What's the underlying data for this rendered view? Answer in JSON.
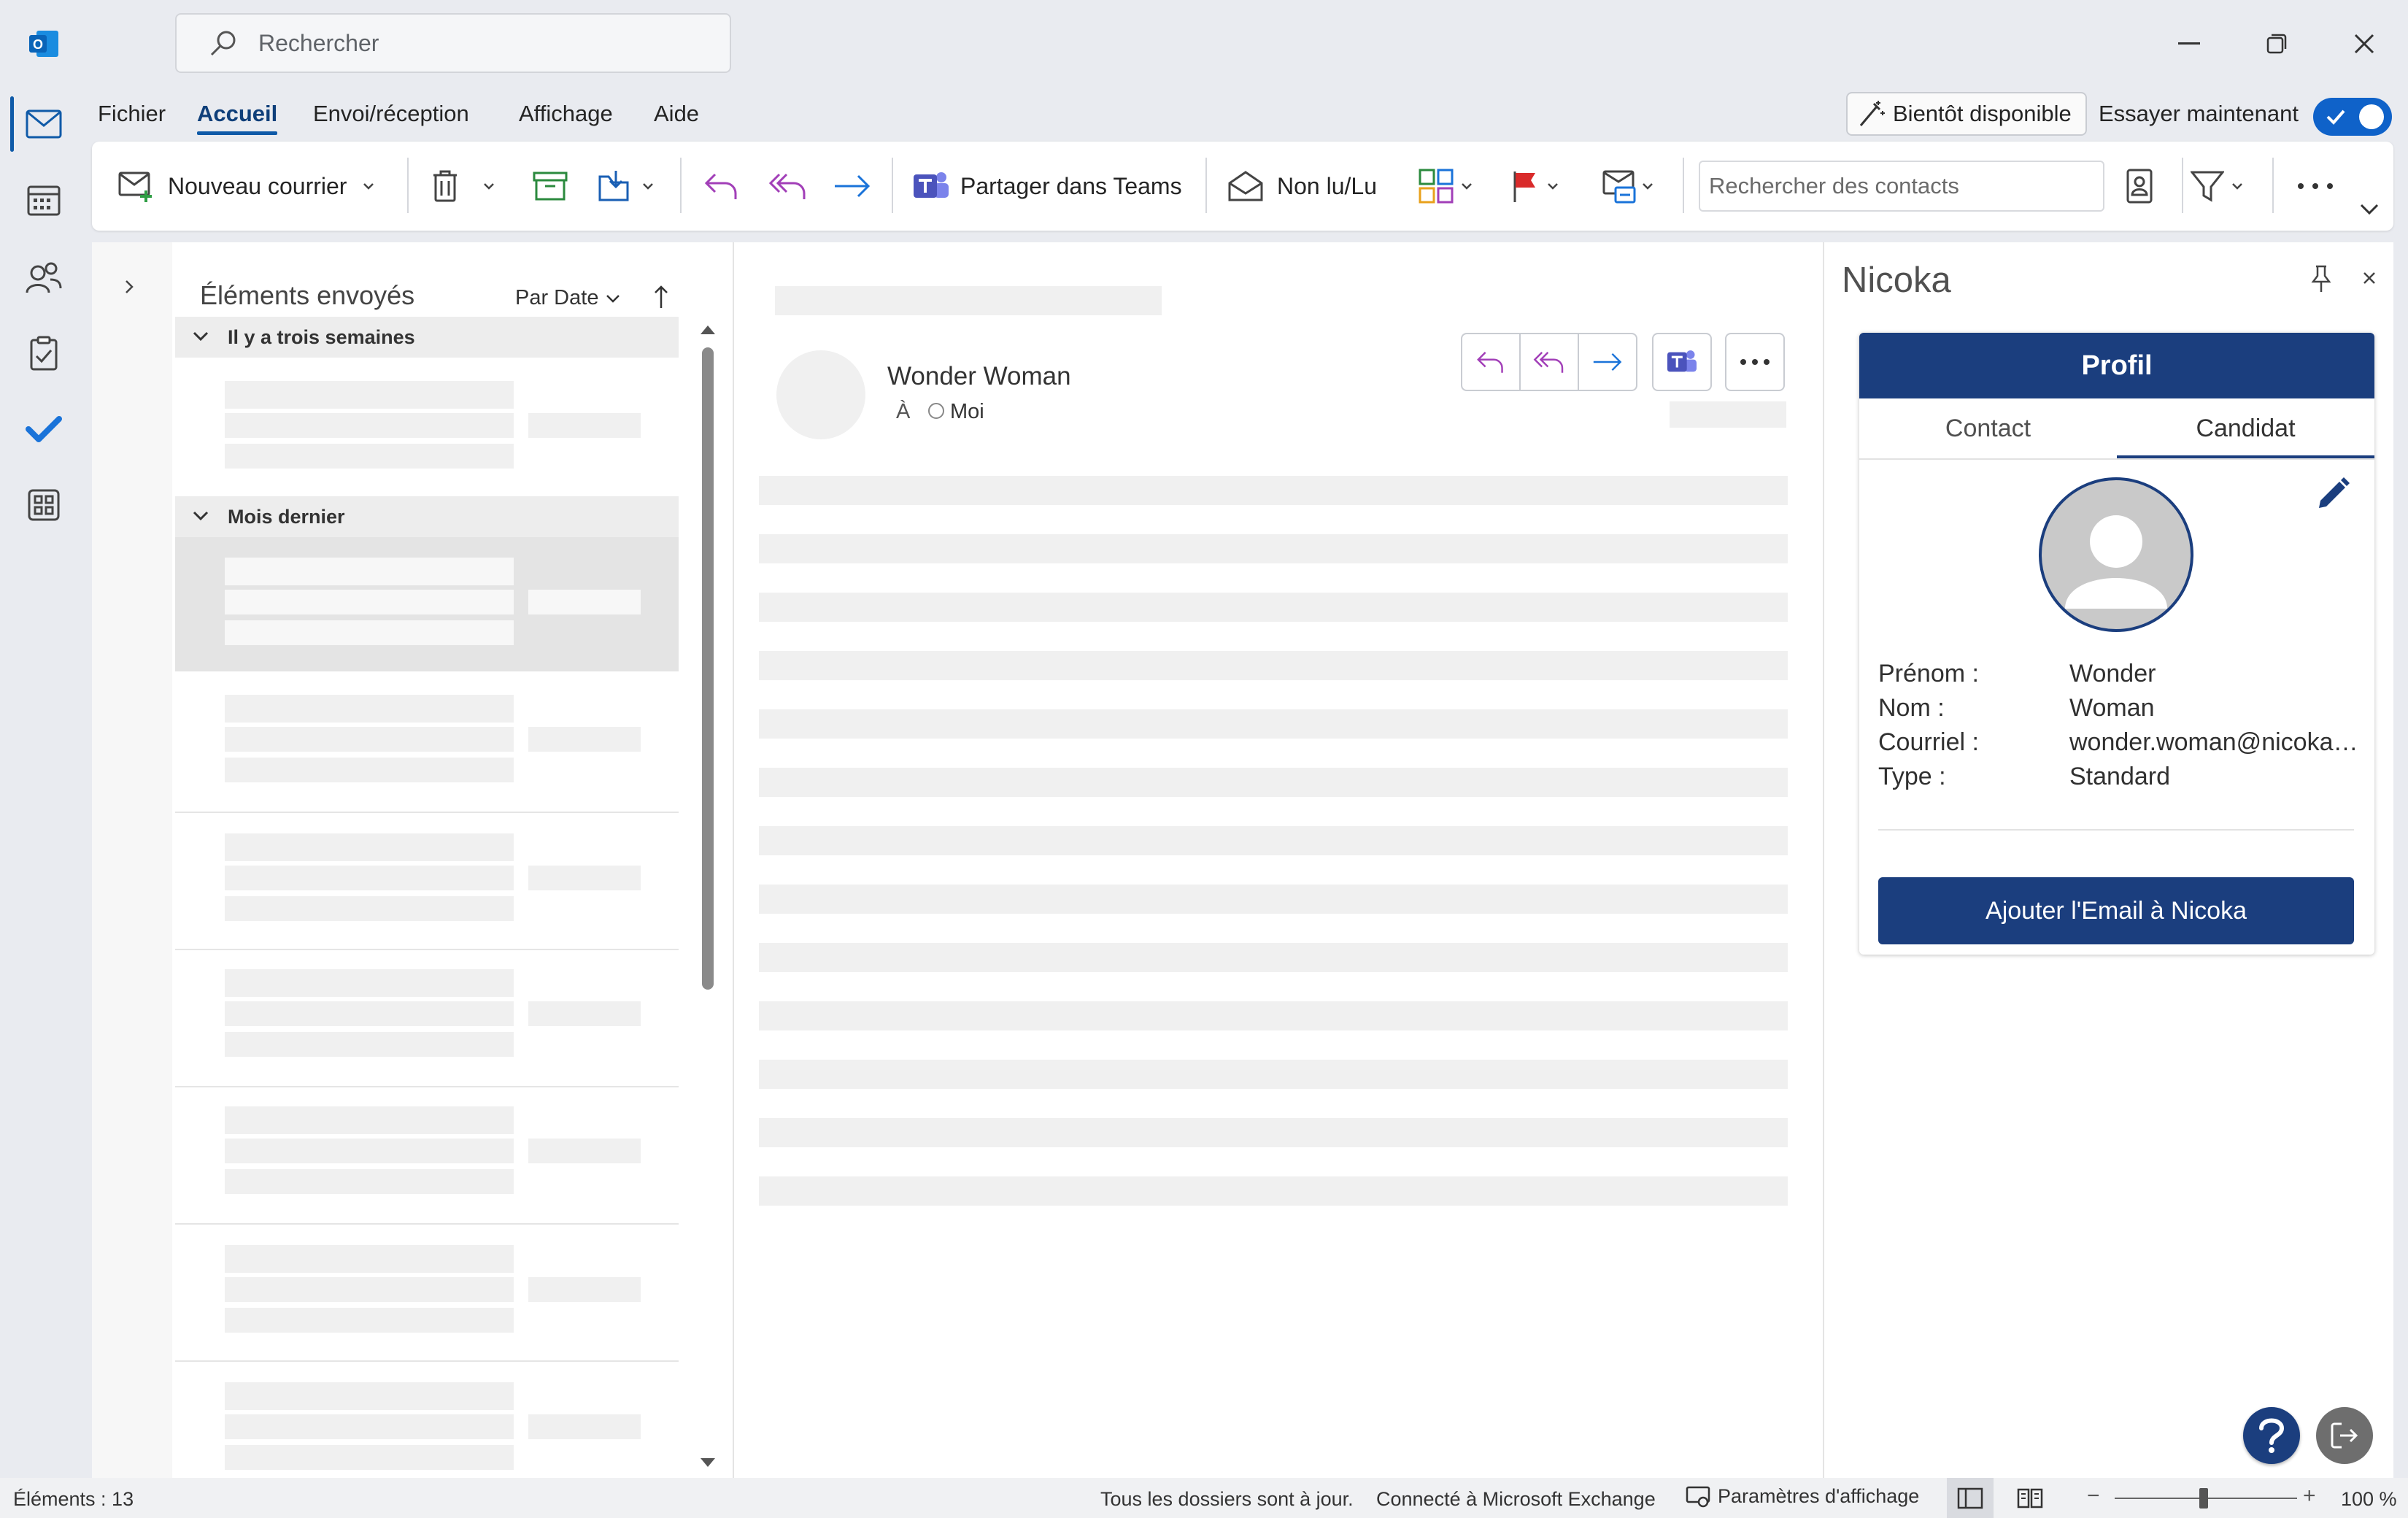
{
  "search": {
    "placeholder": "Rechercher"
  },
  "menu": {
    "fichier": "Fichier",
    "accueil": "Accueil",
    "envoi": "Envoi/réception",
    "affichage": "Affichage",
    "aide": "Aide"
  },
  "soon": {
    "label": "Bientôt disponible",
    "try": "Essayer maintenant"
  },
  "ribbon": {
    "new_mail": "Nouveau courrier",
    "share_teams": "Partager dans Teams",
    "unread_read": "Non lu/Lu",
    "contact_search_placeholder": "Rechercher des contacts"
  },
  "mail_list": {
    "folder": "Éléments envoyés",
    "sort": "Par Date",
    "groups": [
      "Il y a trois semaines",
      "Mois dernier"
    ]
  },
  "reading": {
    "sender": "Wonder Woman",
    "to_label": "À",
    "recipient": "Moi"
  },
  "addin": {
    "title": "Nicoka",
    "card_title": "Profil",
    "tabs": [
      "Contact",
      "Candidat"
    ],
    "fields": [
      {
        "label": "Prénom :",
        "value": "Wonder"
      },
      {
        "label": "Nom :",
        "value": "Woman"
      },
      {
        "label": "Courriel :",
        "value": "wonder.woman@nicoka.com"
      },
      {
        "label": "Type :",
        "value": "Standard"
      }
    ],
    "add_button": "Ajouter l'Email à Nicoka"
  },
  "status": {
    "items": "Éléments : 13",
    "sync": "Tous les dossiers sont à jour.",
    "connection": "Connecté à Microsoft Exchange",
    "display_settings": "Paramètres d'affichage",
    "zoom": "100 %"
  },
  "colors": {
    "accent": "#0f5aa8",
    "nicoka_blue": "#1b3e7e",
    "toggle": "#0f62c9"
  },
  "icons": [
    "outlook-logo-icon",
    "mail-icon",
    "calendar-icon",
    "people-icon",
    "tasks-icon",
    "todo-check-icon",
    "apps-icon",
    "search-icon",
    "minimize-icon",
    "restore-icon",
    "close-icon",
    "wand-icon",
    "new-mail-icon",
    "delete-icon",
    "archive-icon",
    "move-icon",
    "reply-icon",
    "reply-all-icon",
    "forward-icon",
    "teams-icon",
    "envelope-open-icon",
    "categorize-icon",
    "flag-icon",
    "rules-icon",
    "address-book-icon",
    "filter-icon",
    "more-icon",
    "pin-icon",
    "edit-pencil-icon",
    "help-icon",
    "logout-icon"
  ]
}
